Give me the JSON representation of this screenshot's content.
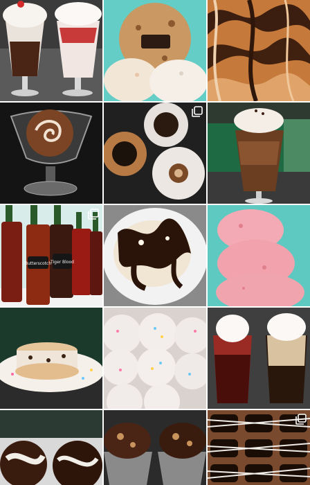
{
  "grid": {
    "posts": [
      {
        "subject": "sundaes-in-tall-glasses",
        "multi": false
      },
      {
        "subject": "candy-bar-cookie-and-ice-cream",
        "multi": false
      },
      {
        "subject": "caramel-fudge-swirl",
        "multi": false
      },
      {
        "subject": "sundae-dish-with-swirl-ball",
        "multi": false
      },
      {
        "subject": "three-ice-cream-pies",
        "multi": true
      },
      {
        "subject": "iced-coffee-float",
        "multi": false
      },
      {
        "subject": "syrup-bottles",
        "multi": true,
        "labels": [
          "Butterscotch",
          "Tiger Blood"
        ]
      },
      {
        "subject": "fudge-sundae-bowl",
        "multi": false
      },
      {
        "subject": "strawberry-ice-cream-scoop",
        "multi": false
      },
      {
        "subject": "ice-cream-cookie-sandwich",
        "multi": false
      },
      {
        "subject": "sprinkle-cookies",
        "multi": false
      },
      {
        "subject": "floats-in-glasses",
        "multi": false
      },
      {
        "subject": "chocolate-hot-cocoa-bombs",
        "multi": false
      },
      {
        "subject": "cookie-sundaes",
        "multi": false
      },
      {
        "subject": "chocolate-drizzled-treats",
        "multi": true
      }
    ]
  },
  "colors": {
    "teal": "#5fc9c3",
    "chocolate": "#3a1f12",
    "caramel": "#b5652a",
    "cream": "#f4ece2",
    "pink": "#f2a7b0",
    "dark": "#1e1e1e"
  }
}
